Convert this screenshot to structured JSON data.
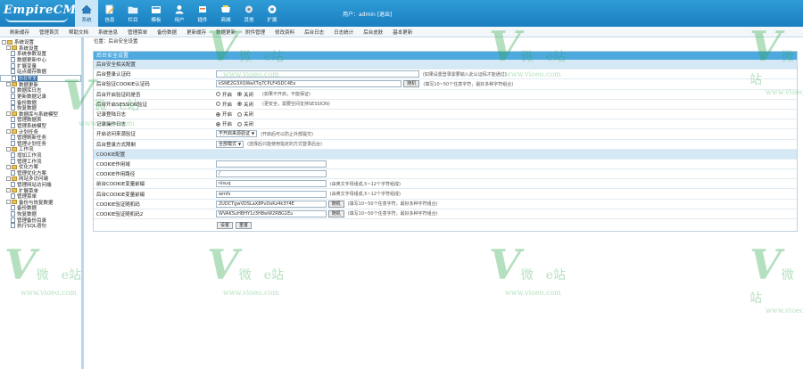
{
  "header": {
    "logo": "EmpireCMS",
    "nav": [
      {
        "label": "系统",
        "icon": "home-icon",
        "active": true
      },
      {
        "label": "信息",
        "icon": "pencil-icon"
      },
      {
        "label": "栏目",
        "icon": "folder-icon"
      },
      {
        "label": "模板",
        "icon": "template-icon"
      },
      {
        "label": "用户",
        "icon": "user-icon"
      },
      {
        "label": "插件",
        "icon": "plugin-icon"
      },
      {
        "label": "商城",
        "icon": "shop-icon"
      },
      {
        "label": "其他",
        "icon": "gear-icon"
      },
      {
        "label": "扩展",
        "icon": "extend-icon"
      }
    ],
    "user_text": "用户：admin [退出]"
  },
  "menubar": [
    "刷新缓存",
    "管理首页",
    "帮助文档",
    "系统信息",
    "管理菜单",
    "备份数据",
    "更新缓存",
    "数据更新",
    "附件管理",
    "修改资料",
    "后台日志",
    "日志统计",
    "后台皮肤",
    "基本更新"
  ],
  "sidebar": [
    {
      "text": "系统设置",
      "level": 0,
      "kind": "root"
    },
    {
      "text": "系统设置",
      "level": 1,
      "kind": "folder"
    },
    {
      "text": "系统参数设置",
      "level": 2,
      "kind": "doc"
    },
    {
      "text": "数据更新中心",
      "level": 2,
      "kind": "doc"
    },
    {
      "text": "扩展变量",
      "level": 2,
      "kind": "doc"
    },
    {
      "text": "站点缓存数据",
      "level": 2,
      "kind": "doc"
    },
    {
      "text": "后台安全",
      "level": 2,
      "kind": "doc",
      "selected": true
    },
    {
      "text": "数据更新",
      "level": 1,
      "kind": "folder"
    },
    {
      "text": "数据库日志",
      "level": 2,
      "kind": "doc"
    },
    {
      "text": "更新数据记录",
      "level": 2,
      "kind": "doc"
    },
    {
      "text": "备份数据",
      "level": 2,
      "kind": "doc"
    },
    {
      "text": "恢复数据",
      "level": 2,
      "kind": "doc"
    },
    {
      "text": "数据库与系统模型",
      "level": 1,
      "kind": "folder"
    },
    {
      "text": "管理数据表",
      "level": 2,
      "kind": "doc"
    },
    {
      "text": "管理系统模型",
      "level": 2,
      "kind": "doc"
    },
    {
      "text": "计划任务",
      "level": 1,
      "kind": "folder"
    },
    {
      "text": "管理刷新任务",
      "level": 2,
      "kind": "doc"
    },
    {
      "text": "管理计划任务",
      "level": 2,
      "kind": "doc"
    },
    {
      "text": "工作流",
      "level": 1,
      "kind": "folder"
    },
    {
      "text": "增加工作流",
      "level": 2,
      "kind": "doc"
    },
    {
      "text": "管理工作流",
      "level": 2,
      "kind": "doc"
    },
    {
      "text": "优化方案",
      "level": 1,
      "kind": "folder"
    },
    {
      "text": "管理优化方案",
      "level": 2,
      "kind": "doc"
    },
    {
      "text": "网站多访问端",
      "level": 1,
      "kind": "folder"
    },
    {
      "text": "管理网站访问端",
      "level": 2,
      "kind": "doc"
    },
    {
      "text": "扩展菜单",
      "level": 1,
      "kind": "folder"
    },
    {
      "text": "管理菜单",
      "level": 2,
      "kind": "doc"
    },
    {
      "text": "备份与恢复数据",
      "level": 1,
      "kind": "folder"
    },
    {
      "text": "备份数据",
      "level": 2,
      "kind": "doc"
    },
    {
      "text": "恢复数据",
      "level": 2,
      "kind": "doc"
    },
    {
      "text": "管理备份目录",
      "level": 2,
      "kind": "doc"
    },
    {
      "text": "执行SQL语句",
      "level": 2,
      "kind": "doc"
    }
  ],
  "main": {
    "breadcrumb": "位置：后台安全设置",
    "panel_title": "后台安全设置",
    "section1": "后台安全相关配置",
    "rows1": [
      {
        "type": "input",
        "label": "后台登录认证码",
        "value": "",
        "w": 0.35,
        "hint": "(如果设置登录需要输入此认证码才能通过)"
      },
      {
        "type": "input_btn",
        "label": "后台验证COOKIE认证码",
        "value": "kSNE2G3XQWaXTq7CPLF4SDC4Eo",
        "w": 0.32,
        "btn": "随机",
        "hint": "(填写10~50个任意字符，最好多种字符组合)"
      },
      {
        "type": "radio",
        "label": "后台开启验证码是否",
        "options": [
          "开启",
          "关闭"
        ],
        "selected": 1,
        "hint": "(如果不开启，不能保证)"
      },
      {
        "type": "radio",
        "label": "后台开启SESSION验证",
        "options": [
          "开启",
          "关闭"
        ],
        "selected": 1,
        "hint": "(更安全，需要空间支持SESSION)"
      },
      {
        "type": "radio",
        "label": "记录登陆日志",
        "options": [
          "开启",
          "关闭"
        ],
        "selected": 0,
        "hint": ""
      },
      {
        "type": "radio",
        "label": "记录操作日志",
        "options": [
          "开启",
          "关闭"
        ],
        "selected": 0,
        "hint": ""
      },
      {
        "type": "select",
        "label": "开启访问来源验证",
        "value": "不开启来源验证",
        "hint": "(开启后可以防止外部提交)"
      },
      {
        "type": "select",
        "label": "后台登录方式限制",
        "value": "全部模式",
        "hint": "(选择后只能使用指定的方式登录后台)"
      }
    ],
    "section2": "COOKIE配置",
    "rows2": [
      {
        "type": "input",
        "label": "COOKIE作用域",
        "value": "",
        "w": 0.19,
        "hint": ""
      },
      {
        "type": "input",
        "label": "COOKIE作用路径",
        "value": "/",
        "w": 0.19,
        "hint": ""
      },
      {
        "type": "input",
        "label": "前台COOKIE变量前缀",
        "value": "nlsuq",
        "w": 0.19,
        "hint": "(由英文字母组成,5~12个字符组成)"
      },
      {
        "type": "input",
        "label": "后台COOKIE变量前缀",
        "value": "wmfs",
        "w": 0.19,
        "hint": "(由英文字母组成,5~12个字符组成)"
      },
      {
        "type": "input_btn",
        "label": "COOKIE验证随机码",
        "value": "2UDCTgwVDSLaX8PvDoKz4k3Y4E",
        "w": 0.19,
        "btn": "随机",
        "hint": "(填写10~50个任意字符，最好多种字符组合)"
      },
      {
        "type": "input_btn",
        "label": "COOKIE验证随机码2",
        "value": "WVAKSuHBHY1z3H8wW2RBG1Eu",
        "w": 0.19,
        "btn": "随机",
        "hint": "(填写10~50个任意字符，最好多种字符组合)"
      }
    ],
    "submit_label": "设置",
    "reset_label": "重置"
  },
  "watermark": {
    "brand": "微",
    "sub": "e站",
    "url": "www.vioeo.com",
    "color": "#2da84a"
  }
}
